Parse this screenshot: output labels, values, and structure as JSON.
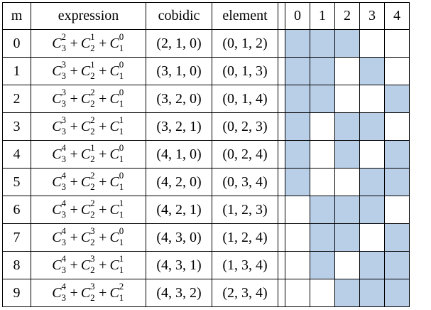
{
  "headers": {
    "m": "m",
    "expression": "expression",
    "cobidic": "cobidic",
    "element": "element",
    "bits": [
      "0",
      "1",
      "2",
      "3",
      "4"
    ]
  },
  "rows": [
    {
      "m": "0",
      "terms": [
        {
          "sup": "2",
          "sub": "3"
        },
        {
          "sup": "1",
          "sub": "2"
        },
        {
          "sup": "0",
          "sub": "1"
        }
      ],
      "cobidic": "(2, 1, 0)",
      "element": "(0, 1, 2)",
      "bits": [
        1,
        1,
        1,
        0,
        0
      ]
    },
    {
      "m": "1",
      "terms": [
        {
          "sup": "3",
          "sub": "3"
        },
        {
          "sup": "1",
          "sub": "2"
        },
        {
          "sup": "0",
          "sub": "1"
        }
      ],
      "cobidic": "(3, 1, 0)",
      "element": "(0, 1, 3)",
      "bits": [
        1,
        1,
        0,
        1,
        0
      ]
    },
    {
      "m": "2",
      "terms": [
        {
          "sup": "3",
          "sub": "3"
        },
        {
          "sup": "2",
          "sub": "2"
        },
        {
          "sup": "0",
          "sub": "1"
        }
      ],
      "cobidic": "(3, 2, 0)",
      "element": "(0, 1, 4)",
      "bits": [
        1,
        1,
        0,
        0,
        1
      ]
    },
    {
      "m": "3",
      "terms": [
        {
          "sup": "3",
          "sub": "3"
        },
        {
          "sup": "2",
          "sub": "2"
        },
        {
          "sup": "1",
          "sub": "1"
        }
      ],
      "cobidic": "(3, 2, 1)",
      "element": "(0, 2, 3)",
      "bits": [
        1,
        0,
        1,
        1,
        0
      ]
    },
    {
      "m": "4",
      "terms": [
        {
          "sup": "4",
          "sub": "3"
        },
        {
          "sup": "1",
          "sub": "2"
        },
        {
          "sup": "0",
          "sub": "1"
        }
      ],
      "cobidic": "(4, 1, 0)",
      "element": "(0, 2, 4)",
      "bits": [
        1,
        0,
        1,
        0,
        1
      ]
    },
    {
      "m": "5",
      "terms": [
        {
          "sup": "4",
          "sub": "3"
        },
        {
          "sup": "2",
          "sub": "2"
        },
        {
          "sup": "0",
          "sub": "1"
        }
      ],
      "cobidic": "(4, 2, 0)",
      "element": "(0, 3, 4)",
      "bits": [
        1,
        0,
        0,
        1,
        1
      ]
    },
    {
      "m": "6",
      "terms": [
        {
          "sup": "4",
          "sub": "3"
        },
        {
          "sup": "2",
          "sub": "2"
        },
        {
          "sup": "1",
          "sub": "1"
        }
      ],
      "cobidic": "(4, 2, 1)",
      "element": "(1, 2, 3)",
      "bits": [
        0,
        1,
        1,
        1,
        0
      ]
    },
    {
      "m": "7",
      "terms": [
        {
          "sup": "4",
          "sub": "3"
        },
        {
          "sup": "3",
          "sub": "2"
        },
        {
          "sup": "0",
          "sub": "1"
        }
      ],
      "cobidic": "(4, 3, 0)",
      "element": "(1, 2, 4)",
      "bits": [
        0,
        1,
        1,
        0,
        1
      ]
    },
    {
      "m": "8",
      "terms": [
        {
          "sup": "4",
          "sub": "3"
        },
        {
          "sup": "3",
          "sub": "2"
        },
        {
          "sup": "1",
          "sub": "1"
        }
      ],
      "cobidic": "(4, 3, 1)",
      "element": "(1, 3, 4)",
      "bits": [
        0,
        1,
        0,
        1,
        1
      ]
    },
    {
      "m": "9",
      "terms": [
        {
          "sup": "4",
          "sub": "3"
        },
        {
          "sup": "3",
          "sub": "2"
        },
        {
          "sup": "2",
          "sub": "1"
        }
      ],
      "cobidic": "(4, 3, 2)",
      "element": "(2, 3, 4)",
      "bits": [
        0,
        0,
        1,
        1,
        1
      ]
    }
  ],
  "symbols": {
    "C": "C",
    "plus": "+"
  },
  "colors": {
    "filled_cell": "#b9cfe8",
    "grid": "#000000"
  }
}
